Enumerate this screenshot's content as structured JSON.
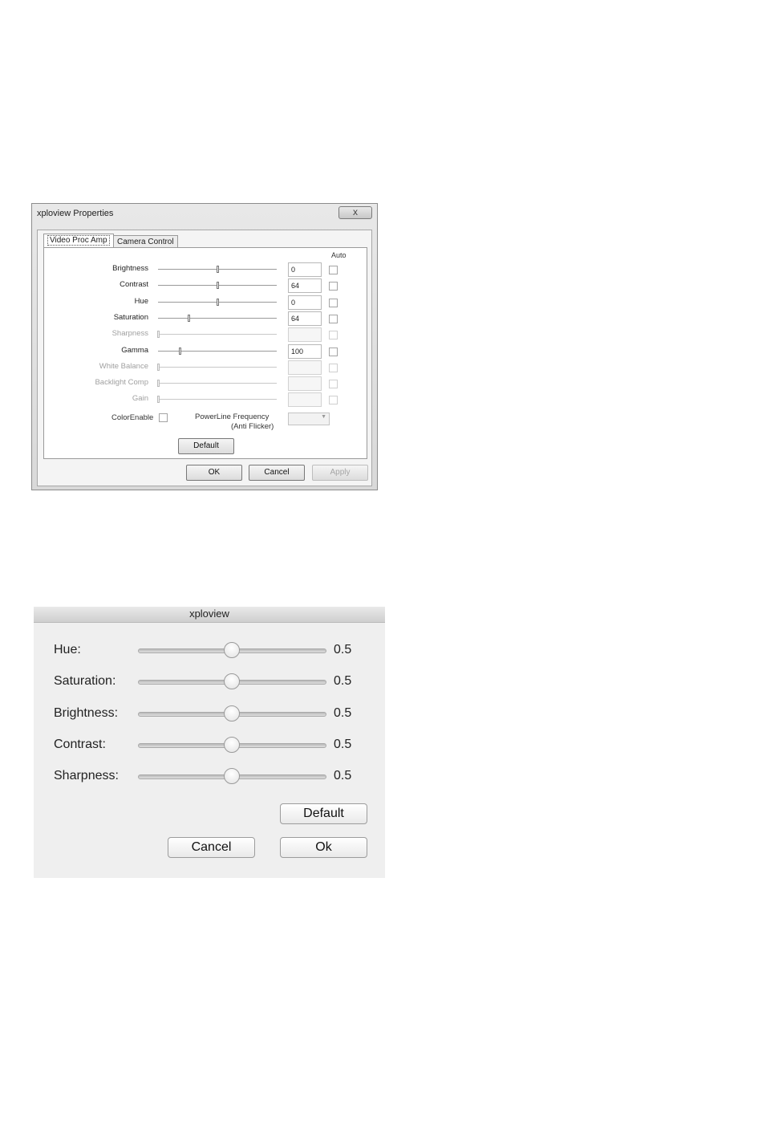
{
  "win_dialog": {
    "title": "xploview Properties",
    "close_glyph": "x",
    "tabs": [
      {
        "label": "Video Proc Amp",
        "active": true
      },
      {
        "label": "Camera Control",
        "active": false
      }
    ],
    "auto_header": "Auto",
    "rows": [
      {
        "label": "Brightness",
        "value": "0",
        "level": 0.5,
        "enabled": true
      },
      {
        "label": "Contrast",
        "value": "64",
        "level": 0.5,
        "enabled": true
      },
      {
        "label": "Hue",
        "value": "0",
        "level": 0.5,
        "enabled": true
      },
      {
        "label": "Saturation",
        "value": "64",
        "level": 0.26,
        "enabled": true
      },
      {
        "label": "Sharpness",
        "value": "",
        "level": 0.0,
        "enabled": false
      },
      {
        "label": "Gamma",
        "value": "100",
        "level": 0.18,
        "enabled": true
      },
      {
        "label": "White Balance",
        "value": "",
        "level": 0.0,
        "enabled": false
      },
      {
        "label": "Backlight Comp",
        "value": "",
        "level": 0.0,
        "enabled": false
      },
      {
        "label": "Gain",
        "value": "",
        "level": 0.0,
        "enabled": false
      }
    ],
    "color_enable_label": "ColorEnable",
    "powerline_label": "PowerLine Frequency",
    "powerline_sub": "(Anti Flicker)",
    "default_label": "Default",
    "ok_label": "OK",
    "cancel_label": "Cancel",
    "apply_label": "Apply"
  },
  "mac_dialog": {
    "title": "xploview",
    "rows": [
      {
        "label": "Hue:",
        "value": "0.5",
        "level": 0.5
      },
      {
        "label": "Saturation:",
        "value": "0.5",
        "level": 0.5
      },
      {
        "label": "Brightness:",
        "value": "0.5",
        "level": 0.5
      },
      {
        "label": "Contrast:",
        "value": "0.5",
        "level": 0.5
      },
      {
        "label": "Sharpness:",
        "value": "0.5",
        "level": 0.5
      }
    ],
    "default_label": "Default",
    "cancel_label": "Cancel",
    "ok_label": "Ok"
  }
}
